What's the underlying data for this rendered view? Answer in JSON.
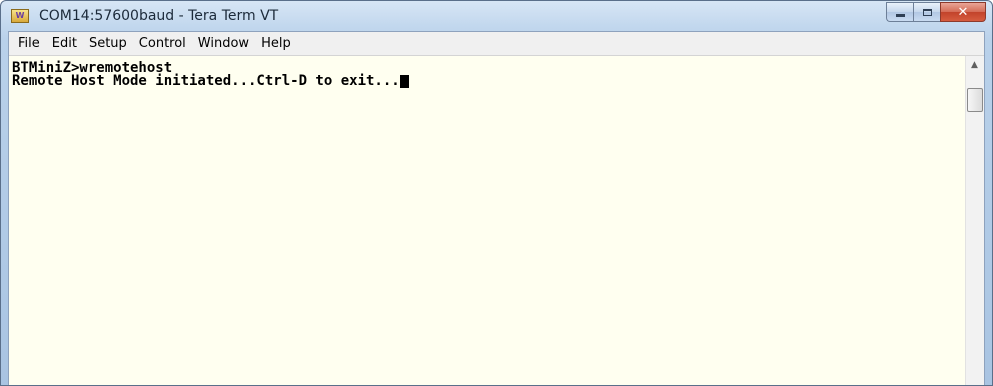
{
  "window": {
    "title": "COM14:57600baud - Tera Term VT",
    "app_icon_label": "W"
  },
  "menu": [
    {
      "label": "File"
    },
    {
      "label": "Edit"
    },
    {
      "label": "Setup"
    },
    {
      "label": "Control"
    },
    {
      "label": "Window"
    },
    {
      "label": "Help"
    }
  ],
  "terminal": {
    "lines": [
      "BTMiniZ>wremotehost",
      "Remote Host Mode initiated...Ctrl-D to exit..."
    ]
  },
  "icons": {
    "app": "tera-term-icon",
    "minimize": "minimize-icon",
    "maximize": "maximize-icon",
    "close": "close-icon",
    "scroll_up": "chevron-up-icon"
  },
  "colors": {
    "terminal_background": "#fffff0",
    "terminal_text": "#000000",
    "close_button": "#c2432b"
  }
}
